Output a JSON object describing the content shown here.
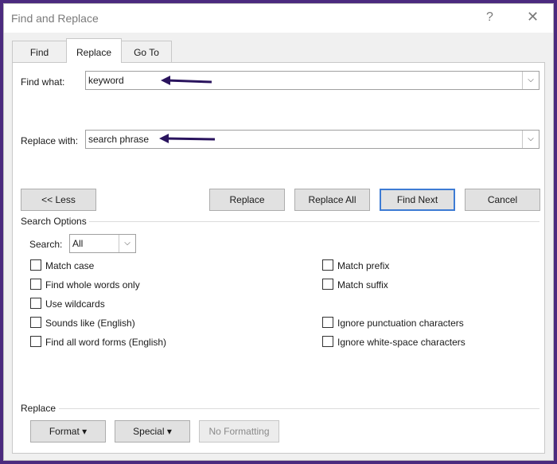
{
  "window": {
    "title": "Find and Replace",
    "help_glyph": "?",
    "close_glyph": "✕"
  },
  "tabs": [
    {
      "label": "Find",
      "active": false
    },
    {
      "label": "Replace",
      "active": true
    },
    {
      "label": "Go To",
      "active": false
    }
  ],
  "find": {
    "label": "Find what:",
    "value": "keyword"
  },
  "replace": {
    "label": "Replace with:",
    "value": "search phrase"
  },
  "buttons": {
    "less": "<< Less",
    "replace": "Replace",
    "replace_all": "Replace All",
    "find_next": "Find Next",
    "cancel": "Cancel"
  },
  "search_options": {
    "heading": "Search Options",
    "search_label": "Search:",
    "search_value": "All",
    "left": [
      {
        "label": "Match case",
        "checked": false
      },
      {
        "label": "Find whole words only",
        "checked": false
      },
      {
        "label": "Use wildcards",
        "checked": false
      },
      {
        "label": "Sounds like (English)",
        "checked": false
      },
      {
        "label": "Find all word forms (English)",
        "checked": false
      }
    ],
    "right": [
      {
        "label": "Match prefix",
        "checked": false
      },
      {
        "label": "Match suffix",
        "checked": false
      },
      {
        "label": "Ignore punctuation characters",
        "checked": false
      },
      {
        "label": "Ignore white-space characters",
        "checked": false
      }
    ]
  },
  "replace_section": {
    "heading": "Replace",
    "format": "Format ▾",
    "special": "Special ▾",
    "no_formatting": "No Formatting"
  },
  "colors": {
    "arrow": "#2a145e",
    "accent": "#3d7bd4",
    "frame": "#4b2a7e"
  }
}
